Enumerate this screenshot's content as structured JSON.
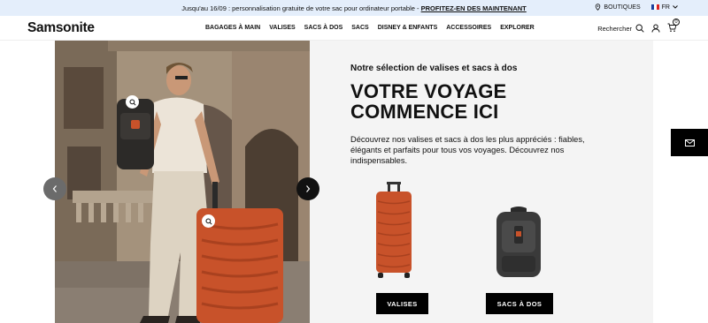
{
  "promo": {
    "text": "Jusqu'au 16/09 : personnalisation gratuite de votre sac pour ordinateur portable - ",
    "link": "PROFITEZ-EN DES MAINTENANT",
    "stores": "BOUTIQUES",
    "lang": "FR"
  },
  "header": {
    "logo": "Samsonite",
    "nav": [
      "BAGAGES À MAIN",
      "VALISES",
      "SACS À DOS",
      "SACS",
      "DISNEY & ENFANTS",
      "ACCESSOIRES",
      "EXPLORER"
    ],
    "search_label": "Rechercher",
    "cart_count": "0"
  },
  "hero": {
    "subtitle": "Notre sélection de valises et sacs à dos",
    "title_line1": "VOTRE VOYAGE",
    "title_line2": "COMMENCE ICI",
    "description": "Découvrez nos valises et sacs à dos les plus appréciés : fiables, élégants et parfaits pour tous vos voyages. Découvrez nos indispensables.",
    "cta_suitcases": "VALISES",
    "cta_backpacks": "SACS À DOS"
  },
  "colors": {
    "accent_orange": "#c8522a",
    "promo_bg": "#e4eefb",
    "hero_bg": "#f4f4f4"
  }
}
